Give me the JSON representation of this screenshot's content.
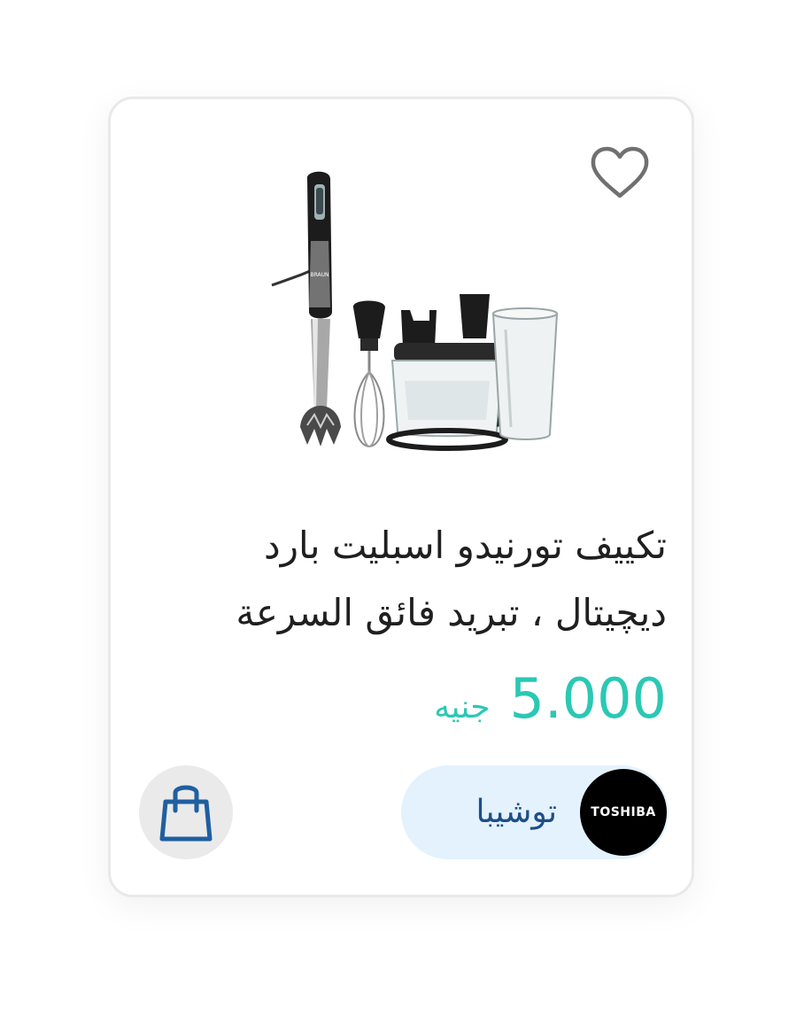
{
  "product": {
    "title": "تكييف تورنيدو اسبليت بارد ديچيتال ، تبريد فائق السرعة",
    "price": "5.000",
    "currency": "جنيه",
    "image_logo_text": "BRAUN"
  },
  "brand": {
    "name": "توشيبا",
    "logo_text": "TOSHIBA"
  },
  "icons": {
    "favorite": "heart-outline-icon",
    "cart": "shopping-bag-icon"
  },
  "colors": {
    "price": "#2bc8b4",
    "brand_pill_bg": "#e3f2fd",
    "brand_text": "#1e4e86",
    "cart_icon": "#1f5fa0",
    "cart_btn_bg": "#eaeaea"
  }
}
